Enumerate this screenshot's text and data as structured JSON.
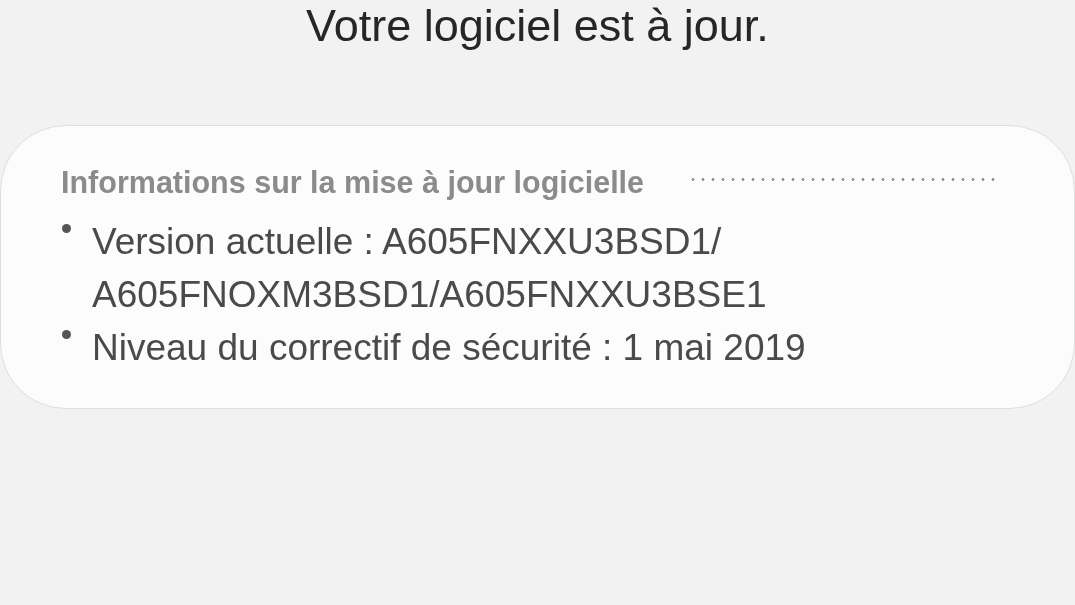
{
  "header": {
    "title": "Votre logiciel est à jour."
  },
  "info_card": {
    "title": "Informations sur la mise à jour logicielle",
    "items": [
      "Version actuelle : A605FNXXU3BSD1/A605FNOXM3BSD1/A605FNXXU3BSE1",
      "Niveau du correctif de sécurité : 1 mai 2019"
    ]
  }
}
